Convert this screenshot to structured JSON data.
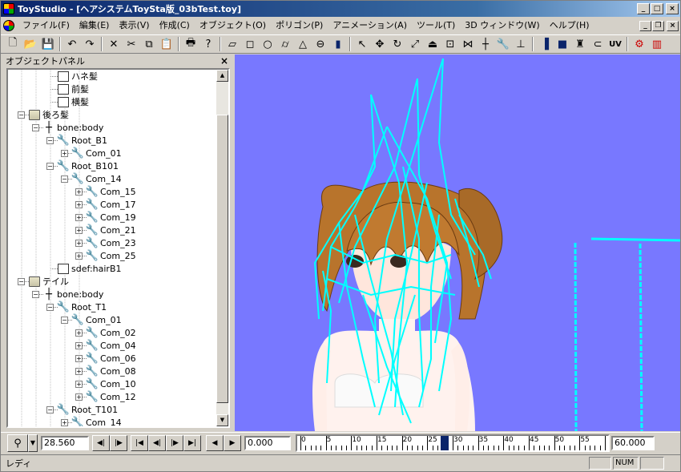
{
  "window": {
    "title": "ToyStudio - [ヘアシステムToySta版_03bTest.toy]",
    "min": "_",
    "max": "□",
    "close": "×"
  },
  "menu": {
    "items": [
      "ファイル(F)",
      "編集(E)",
      "表示(V)",
      "作成(C)",
      "オブジェクト(O)",
      "ポリゴン(P)",
      "アニメーション(A)",
      "ツール(T)",
      "3D ウィンドウ(W)",
      "ヘルプ(H)"
    ],
    "min": "_",
    "restore": "❐",
    "close": "×"
  },
  "toolbar": {
    "icons": [
      "new-icon",
      "open-icon",
      "save-icon",
      "|",
      "undo-icon",
      "redo-icon",
      "|",
      "delete-icon",
      "cut-icon",
      "copy-icon",
      "paste-icon",
      "|",
      "print-icon",
      "help-icon",
      "|",
      "plane-icon",
      "box-icon",
      "sphere-icon",
      "cylinder-icon",
      "cone-icon",
      "torus-icon",
      "bars-icon",
      "|",
      "select-arrow-icon",
      "move-icon",
      "rotate-icon",
      "scale-icon",
      "extrude-icon",
      "transform-icon",
      "bend-icon",
      "bone-icon",
      "wrench-icon",
      "joint-icon",
      "|",
      "gradient-icon",
      "block-icon",
      "paint-icon",
      "magnet-icon",
      "uv-icon",
      "|",
      "render-icon",
      "split-icon"
    ],
    "glyphs": {
      "new-icon": "🗋",
      "open-icon": "📂",
      "save-icon": "💾",
      "undo-icon": "↶",
      "redo-icon": "↷",
      "delete-icon": "✕",
      "cut-icon": "✂",
      "copy-icon": "⧉",
      "paste-icon": "📋",
      "print-icon": "🖶",
      "help-icon": "?",
      "plane-icon": "▱",
      "box-icon": "◻",
      "sphere-icon": "○",
      "cylinder-icon": "⌭",
      "cone-icon": "△",
      "torus-icon": "⊖",
      "bars-icon": "▮",
      "select-arrow-icon": "↖",
      "move-icon": "✥",
      "rotate-icon": "↻",
      "scale-icon": "⤢",
      "extrude-icon": "⏏",
      "transform-icon": "⊡",
      "bend-icon": "⋈",
      "bone-icon": "┼",
      "wrench-icon": "🔧",
      "joint-icon": "⊥",
      "gradient-icon": "▐",
      "block-icon": "■",
      "paint-icon": "♜",
      "magnet-icon": "⊂",
      "uv-icon": "UV",
      "render-icon": "⚙",
      "split-icon": "▥"
    }
  },
  "panel": {
    "title": "オブジェクトパネル",
    "close": "×",
    "tree": [
      {
        "label": "ハネ髪",
        "depth": 3,
        "icon": "obj",
        "expander": ""
      },
      {
        "label": "前髪",
        "depth": 3,
        "icon": "obj",
        "expander": ""
      },
      {
        "label": "横髪",
        "depth": 3,
        "icon": "obj",
        "expander": ""
      },
      {
        "label": "後ろ髪",
        "depth": 1,
        "icon": "folder",
        "expander": "−"
      },
      {
        "label": "bone:body",
        "depth": 2,
        "icon": "bone",
        "expander": "−"
      },
      {
        "label": "Root_B1",
        "depth": 3,
        "icon": "wrench",
        "expander": "−"
      },
      {
        "label": "Com_01",
        "depth": 4,
        "icon": "wrench",
        "expander": "+"
      },
      {
        "label": "Root_B101",
        "depth": 3,
        "icon": "wrench",
        "expander": "−"
      },
      {
        "label": "Com_14",
        "depth": 4,
        "icon": "wrench",
        "expander": "−"
      },
      {
        "label": "Com_15",
        "depth": 5,
        "icon": "wrench",
        "expander": "+"
      },
      {
        "label": "Com_17",
        "depth": 5,
        "icon": "wrench",
        "expander": "+"
      },
      {
        "label": "Com_19",
        "depth": 5,
        "icon": "wrench",
        "expander": "+"
      },
      {
        "label": "Com_21",
        "depth": 5,
        "icon": "wrench",
        "expander": "+"
      },
      {
        "label": "Com_23",
        "depth": 5,
        "icon": "wrench",
        "expander": "+"
      },
      {
        "label": "Com_25",
        "depth": 5,
        "icon": "wrench",
        "expander": "+"
      },
      {
        "label": "sdef:hairB1",
        "depth": 3,
        "icon": "obj",
        "expander": ""
      },
      {
        "label": "テイル",
        "depth": 1,
        "icon": "folder",
        "expander": "−"
      },
      {
        "label": "bone:body",
        "depth": 2,
        "icon": "bone",
        "expander": "−"
      },
      {
        "label": "Root_T1",
        "depth": 3,
        "icon": "wrench",
        "expander": "−"
      },
      {
        "label": "Com_01",
        "depth": 4,
        "icon": "wrench",
        "expander": "−"
      },
      {
        "label": "Com_02",
        "depth": 5,
        "icon": "wrench",
        "expander": "+"
      },
      {
        "label": "Com_04",
        "depth": 5,
        "icon": "wrench",
        "expander": "+"
      },
      {
        "label": "Com_06",
        "depth": 5,
        "icon": "wrench",
        "expander": "+"
      },
      {
        "label": "Com_08",
        "depth": 5,
        "icon": "wrench",
        "expander": "+"
      },
      {
        "label": "Com_10",
        "depth": 5,
        "icon": "wrench",
        "expander": "+"
      },
      {
        "label": "Com_12",
        "depth": 5,
        "icon": "wrench",
        "expander": "+"
      },
      {
        "label": "Root_T101",
        "depth": 3,
        "icon": "wrench",
        "expander": "−"
      },
      {
        "label": "Com_14",
        "depth": 4,
        "icon": "wrench",
        "expander": "+"
      }
    ]
  },
  "timeline": {
    "current_time": "28.560",
    "start_time": "0.000",
    "end_time": "60.000",
    "ruler_labels": [
      "0",
      "5",
      "10",
      "15",
      "20",
      "25",
      "30",
      "35",
      "40",
      "45",
      "50",
      "55"
    ],
    "cursor_frame": 28
  },
  "status": {
    "text": "レディ",
    "num": "NUM"
  },
  "colors": {
    "viewport_bg": "#7878ff",
    "bone_color": "#00ffff",
    "hair_color": "#b8742c",
    "skin_color": "#ffe0d8"
  }
}
